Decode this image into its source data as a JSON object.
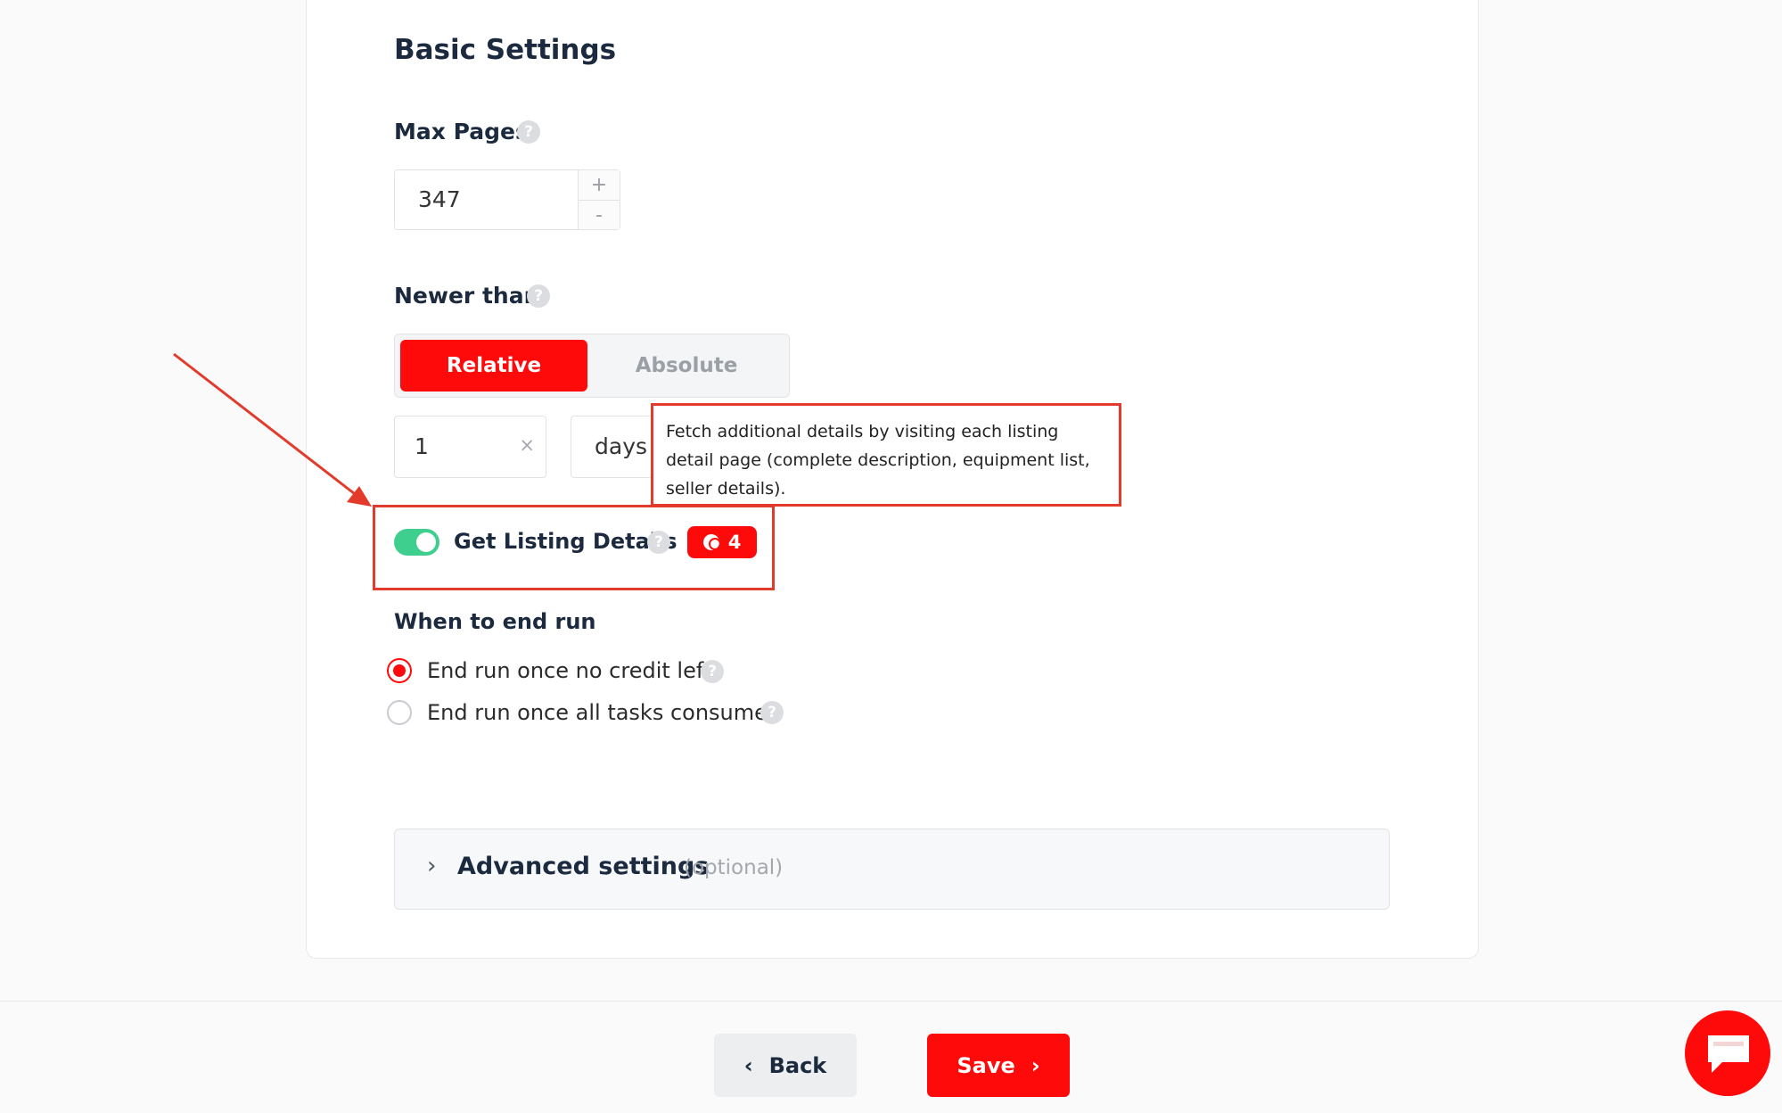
{
  "section_title": "Basic Settings",
  "max_pages": {
    "label": "Max Pages",
    "help": "?",
    "value": "347",
    "increment": "+",
    "decrement": "-"
  },
  "newer_than": {
    "label": "Newer than",
    "help": "?",
    "modes": [
      "Relative",
      "Absolute"
    ],
    "active_mode": "Relative",
    "amount": "1",
    "clear": "×",
    "unit": "days"
  },
  "tooltip_text": "Fetch additional details by visiting each listing detail page (complete description, equipment list, seller details).",
  "listing_details": {
    "label": "Get Listing Details",
    "enabled": true,
    "help": "?",
    "credits": "4"
  },
  "end_run": {
    "label": "When to end run",
    "options": [
      {
        "label": "End run once no credit left",
        "checked": true,
        "help": "?"
      },
      {
        "label": "End run once all tasks consumed",
        "checked": false,
        "help": "?"
      }
    ]
  },
  "advanced": {
    "chevron": "›",
    "title": "Advanced settings",
    "optional": "(optional)"
  },
  "footer": {
    "back_icon": "‹",
    "back_label": "Back",
    "save_label": "Save",
    "save_icon": "›"
  },
  "icons": {
    "chat": "chat-icon",
    "arrow": "annotation-arrow-icon",
    "coin": "coin-icon"
  },
  "colors": {
    "accent": "#ff0a0a",
    "toggle_on": "#3ecf8e",
    "annotation": "#e23b2b",
    "heading": "#1b2a3e"
  }
}
